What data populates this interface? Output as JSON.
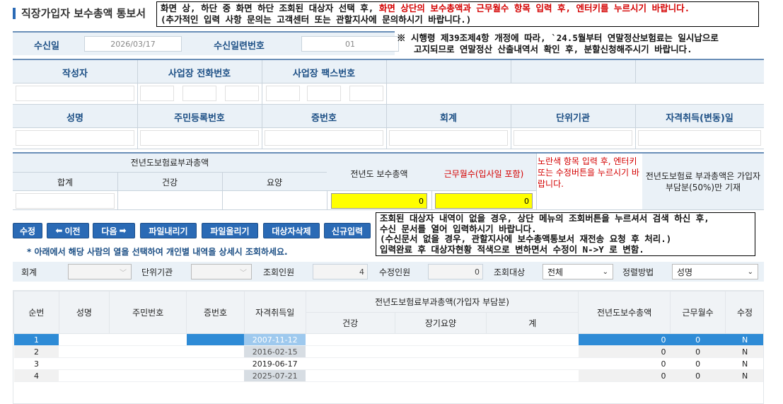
{
  "page_title": "직장가입자 보수총액 통보서",
  "notice_top": {
    "line1_a": "화면 상, 하단 중 화면 하단 조회된 대상자 선택 후, ",
    "line1_b": "화면 상단의 보수총액과 근무월수 항목 입력 후, 엔터키를 누르시기 바랍니다.",
    "line2": "(추가적인 입력 사항 문의는 고객센터 또는 관할지사에 문의하시기 바랍니다.)"
  },
  "notice_law": {
    "line1": "※ 시행령 제39조제4항 개정에 따라, `24.5월부터 연말정산보험료는 일시납으로",
    "line2": "고지되므로 연말정산 산출내역서 확인 후, 분할신청해주시기 바랍니다."
  },
  "receipt": {
    "date_label": "수신일",
    "date_value": "2026/03/17",
    "serial_label": "수신일련번호",
    "serial_value": "01"
  },
  "info_headers": {
    "writer": "작성자",
    "phone": "사업장 전화번호",
    "fax": "사업장 팩스번호",
    "name": "성명",
    "rrn": "주민등록번호",
    "cert_no": "증번호",
    "accounting": "회계",
    "unit": "단위기관",
    "acquire_date": "자격취득(변동)일"
  },
  "premium": {
    "group_label": "전년도보험료부과총액",
    "total": "합계",
    "health": "건강",
    "care": "요양",
    "annual_pay_label": "전년도 보수총액",
    "work_months_label": "근무월수(입사일 포함)",
    "annual_pay_value": "0",
    "work_months_value": "0",
    "hint": "노란색 항목 입력 후, 엔터키 또는 수정버튼을 누르시기 바랍니다.",
    "note": "전년도보험료 부과총액은 가입자부담분(50%)만 기재"
  },
  "buttons": {
    "edit": "수정",
    "prev": "이전",
    "next": "다음",
    "download": "파일내리기",
    "upload": "파일올리기",
    "delete_target": "대상자삭제",
    "new_input": "신규입력"
  },
  "notice_bottom": {
    "line1": "조회된 대상자 내역이 없을 경우, 상단 메뉴의 조회버튼을 누르셔서 검색 하신 후,",
    "line2": "수신 문서를 열어 입력하시기 바랍니다.",
    "line3": "(수신문서 없을 경우, 관할지사에 보수총액통보서 재전송 요청 후 처리.)",
    "line4": "입력완료 후 대상자현황 적색으로 변하면서 수정이 N->Y 로 변함."
  },
  "select_hint": "* 아래에서 해당 사람의 열을 선택하여 개인별 내역을 상세시 조회하세요.",
  "filters": {
    "accounting_label": "회계",
    "unit_label": "단위기관",
    "query_count_label": "조회인원",
    "query_count_value": "4",
    "edit_count_label": "수정인원",
    "edit_count_value": "0",
    "target_label": "조회대상",
    "target_value": "전체",
    "sort_label": "정렬방법",
    "sort_value": "성명"
  },
  "grid": {
    "headers": {
      "seq": "순번",
      "name": "성명",
      "rrn": "주민번호",
      "cert": "증번호",
      "acquire": "자격취득일",
      "premium_group": "전년도보험료부과총액(가입자 부담분)",
      "health": "건강",
      "ltc": "장기요양",
      "sum": "계",
      "annual_pay": "전년도보수총액",
      "months": "근무월수",
      "edited": "수정"
    },
    "rows": [
      {
        "seq": "1",
        "acquire": "2007-11-12",
        "annual_pay": "0",
        "months": "0",
        "edited": "N"
      },
      {
        "seq": "2",
        "acquire": "2016-02-15",
        "annual_pay": "0",
        "months": "0",
        "edited": "N"
      },
      {
        "seq": "3",
        "acquire": "2019-06-17",
        "annual_pay": "0",
        "months": "0",
        "edited": "N"
      },
      {
        "seq": "4",
        "acquire": "2025-07-21",
        "annual_pay": "0",
        "months": "0",
        "edited": "N"
      }
    ]
  }
}
